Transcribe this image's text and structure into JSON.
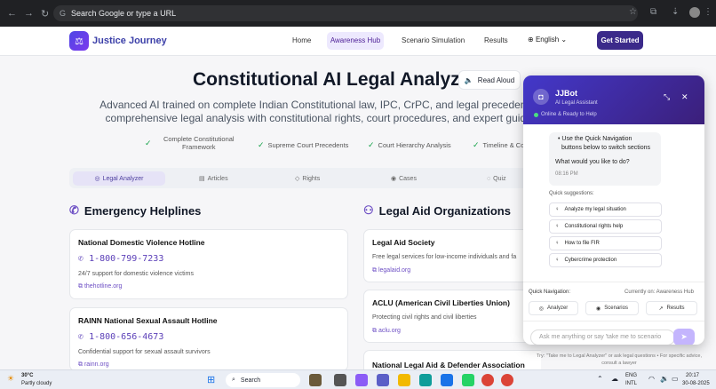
{
  "browser": {
    "address_placeholder": "Search Google or type a URL"
  },
  "header": {
    "brand": "Justice Journey",
    "nav": [
      "Home",
      "Awareness Hub",
      "Scenario Simulation",
      "Results"
    ],
    "language": "English",
    "cta": "Get Started"
  },
  "hero": {
    "title": "Constitutional AI Legal Analyzer",
    "read_aloud": "Read Aloud",
    "subtitle_line1": "Advanced AI trained on complete Indian Constitutional law, IPC, CrPC, and legal precedents. Get",
    "subtitle_line2": "comprehensive legal analysis with constitutional rights, court procedures, and expert guidance.",
    "features": [
      "Complete Constitutional Framework",
      "Supreme Court Precedents",
      "Court Hierarchy Analysis",
      "Timeline & Co"
    ]
  },
  "tabs": [
    "Legal Analyzer",
    "Articles",
    "Rights",
    "Cases",
    "Quiz"
  ],
  "helplines": {
    "title": "Emergency Helplines",
    "items": [
      {
        "name": "National Domestic Violence Hotline",
        "phone": "1-800-799-7233",
        "desc": "24/7 support for domestic violence victims",
        "link": "thehotline.org"
      },
      {
        "name": "RAINN National Sexual Assault Hotline",
        "phone": "1-800-656-4673",
        "desc": "Confidential support for sexual assault survivors",
        "link": "rainn.org"
      }
    ]
  },
  "legal_aid": {
    "title": "Legal Aid Organizations",
    "items": [
      {
        "name": "Legal Aid Society",
        "desc": "Free legal services for low-income individuals and fa",
        "link": "legalaid.org"
      },
      {
        "name": "ACLU (American Civil Liberties Union)",
        "desc": "Protecting civil rights and civil liberties",
        "link": "aclu.org"
      },
      {
        "name": "National Legal Aid & Defender Association"
      }
    ]
  },
  "chatbot": {
    "name": "JJBot",
    "role": "AI Legal Assistant",
    "status": "Online & Ready to Help",
    "msg_line1": "• Use the Quick Navigation",
    "msg_line2": "buttons below to switch sections",
    "msg_line3": "What would you like to do?",
    "msg_time": "08:16 PM",
    "suggest_label": "Quick suggestions:",
    "suggestions": [
      "Analyze my legal situation",
      "Constitutional rights help",
      "How to file FIR",
      "Cybercrime protection"
    ],
    "quicknav_label": "Quick Navigation:",
    "current": "Currently on: Awareness Hub",
    "quicknav": [
      "Analyzer",
      "Scenarios",
      "Results"
    ],
    "input_placeholder": "Ask me anything or say 'take me to scenario",
    "tip": "Try: \"Take me to Legal Analyzer\" or ask legal questions • For specific advice, consult a lawyer"
  },
  "taskbar": {
    "weather_temp": "30°C",
    "weather_desc": "Partly cloudy",
    "search": "Search",
    "lang1": "ENG",
    "lang2": "INTL",
    "time": "20:17",
    "date": "30-08-2025"
  }
}
